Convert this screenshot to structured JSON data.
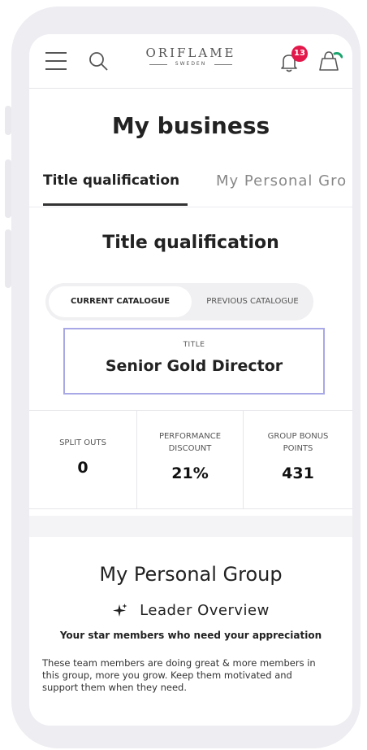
{
  "header": {
    "logo_main": "ORIFLAME",
    "logo_sub": "SWEDEN",
    "notification_count": "13"
  },
  "page": {
    "title": "My business"
  },
  "tabs": [
    {
      "label": "Title qualification",
      "active": true
    },
    {
      "label": "My Personal Gro",
      "active": false
    }
  ],
  "title_qualification": {
    "heading": "Title qualification",
    "catalogue_tabs": {
      "current": "CURRENT CATALOGUE",
      "previous": "PREVIOUS CATALOGUE"
    },
    "title_caption": "TITLE",
    "title_value": "Senior Gold Director",
    "stats": [
      {
        "label": "SPLIT OUTS",
        "value": "0"
      },
      {
        "label": "PERFORMANCE DISCOUNT",
        "value": "21%"
      },
      {
        "label": "GROUP BONUS POINTS",
        "value": "431"
      }
    ]
  },
  "personal_group": {
    "heading": "My Personal Group",
    "leader_overview": "Leader Overview",
    "subtitle": "Your star members who need your appreciation",
    "description": "These team members are doing great & more members in this group, more you grow. Keep them motivated and support them when they need."
  },
  "colors": {
    "badge": "#e3174a",
    "highlight_border": "#a8a8e6",
    "accent_green": "#1aa36c"
  }
}
